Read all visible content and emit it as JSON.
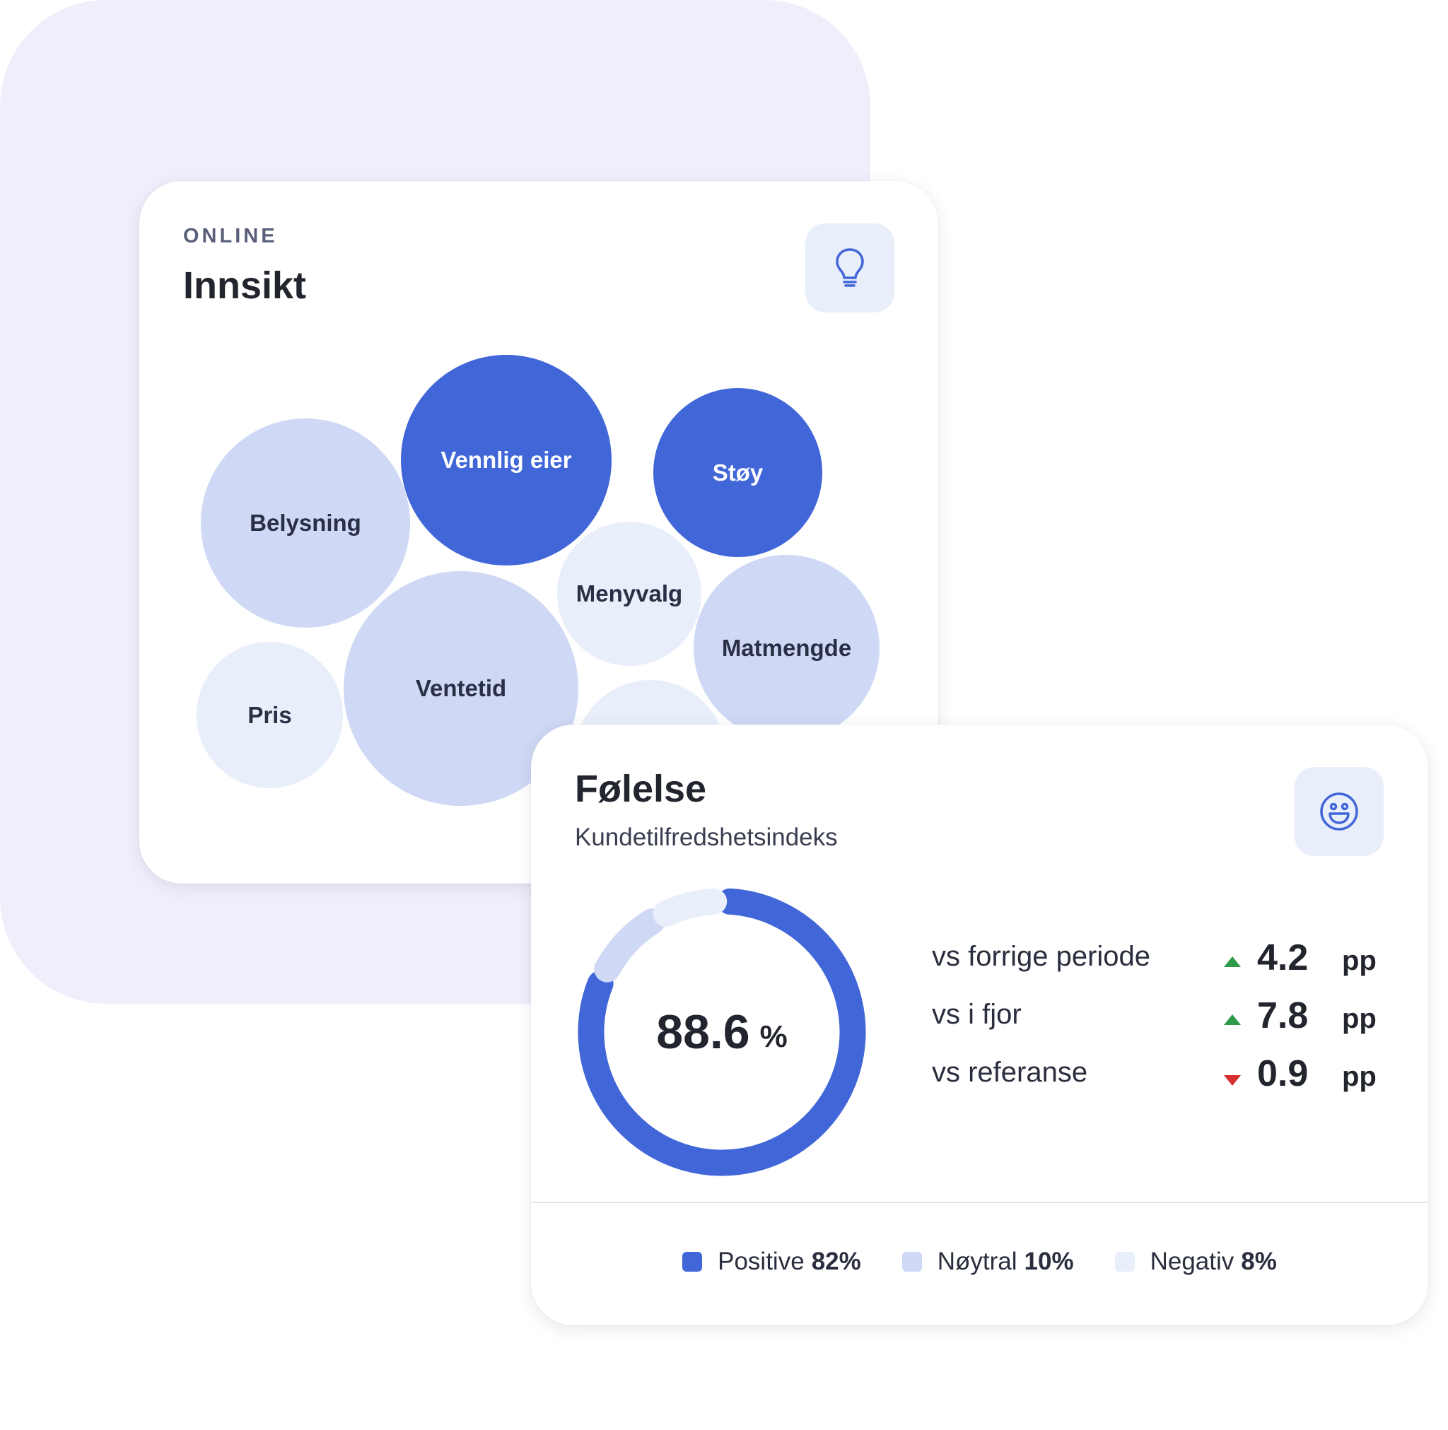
{
  "colors": {
    "background_panel": "#f1eefc",
    "accent": "#4166d8",
    "neutral": "#cfd8f4",
    "light": "#e9eefb",
    "up": "#2e9a47",
    "down": "#d62f2f"
  },
  "insight": {
    "eyebrow": "ONLINE",
    "title": "Innsikt",
    "icon": "lightbulb-icon",
    "bubbles": [
      {
        "label": "Vennlig eier",
        "tone": "dark"
      },
      {
        "label": "Støy",
        "tone": "dark"
      },
      {
        "label": "Belysning",
        "tone": "mid"
      },
      {
        "label": "Menyvalg",
        "tone": "light"
      },
      {
        "label": "Matmengde",
        "tone": "mid"
      },
      {
        "label": "Pris",
        "tone": "light"
      },
      {
        "label": "Ventetid",
        "tone": "mid"
      },
      {
        "label": "",
        "tone": "light"
      }
    ]
  },
  "feeling": {
    "title": "Følelse",
    "subtitle": "Kundetilfredshetsindeks",
    "icon": "smiley-icon",
    "score": {
      "value": "88.6",
      "unit": "%"
    },
    "metrics": [
      {
        "label": "vs forrige periode",
        "direction": "up",
        "value": "4.2",
        "unit": "pp"
      },
      {
        "label": "vs i fjor",
        "direction": "up",
        "value": "7.8",
        "unit": "pp"
      },
      {
        "label": "vs referanse",
        "direction": "down",
        "value": "0.9",
        "unit": "pp"
      }
    ],
    "legend": [
      {
        "label": "Positive",
        "value": "82%",
        "color": "#4166d8"
      },
      {
        "label": "Nøytral",
        "value": "10%",
        "color": "#cfd8f4"
      },
      {
        "label": "Negativ",
        "value": "8%",
        "color": "#e9eefb"
      }
    ]
  },
  "chart_data": {
    "type": "pie",
    "categories": [
      "Positive",
      "Nøytral",
      "Negativ"
    ],
    "values": [
      82,
      10,
      8
    ],
    "title": "",
    "center_label": "88.6 %"
  }
}
